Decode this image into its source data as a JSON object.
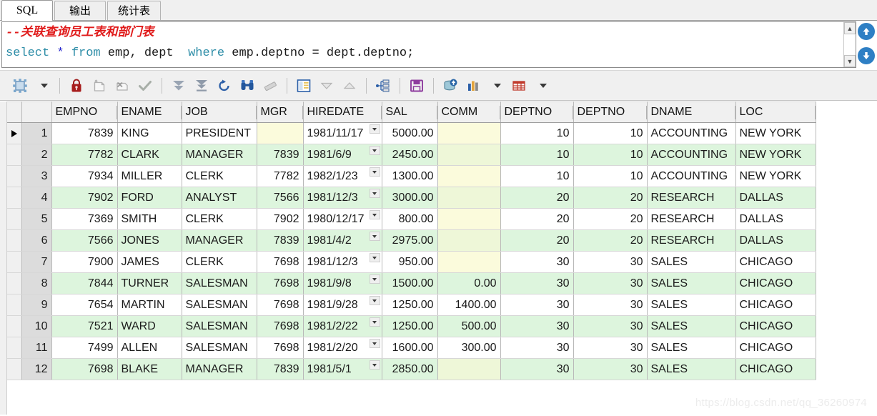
{
  "tabs": [
    {
      "label": "SQL",
      "active": true
    },
    {
      "label": "输出",
      "active": false
    },
    {
      "label": "统计表",
      "active": false
    }
  ],
  "editor": {
    "comment_line": "--关联查询员工表和部门表",
    "sql_tokens": {
      "select": "select",
      "star": "*",
      "from": "from",
      "tables": " emp, dept  ",
      "where": "where",
      "condition": " emp.deptno = dept.deptno;"
    },
    "full_sql": "select * from emp, dept  where emp.deptno = dept.deptno;",
    "scroll_up": "▲",
    "scroll_down": "▼"
  },
  "side_buttons": [
    {
      "name": "scroll-to-top-button",
      "glyph": "↑"
    },
    {
      "name": "scroll-to-bottom-button",
      "glyph": "↓"
    }
  ],
  "toolbar": {
    "items": [
      {
        "name": "grid-view-button",
        "icon": "grid-select-icon",
        "has_caret": true,
        "enabled": true
      },
      {
        "sep": true
      },
      {
        "name": "lock-button",
        "icon": "lock-icon",
        "enabled": true
      },
      {
        "name": "insert-record-button",
        "icon": "new-record-icon",
        "enabled": false
      },
      {
        "name": "delete-record-button",
        "icon": "delete-record-icon",
        "enabled": false
      },
      {
        "name": "post-changes-button",
        "icon": "check-icon",
        "enabled": false
      },
      {
        "sep": true
      },
      {
        "name": "fetch-next-page-button",
        "icon": "double-down-arrow-icon",
        "enabled": true
      },
      {
        "name": "fetch-last-page-button",
        "icon": "down-arrow-to-bar-icon",
        "enabled": true
      },
      {
        "name": "refresh-button",
        "icon": "refresh-icon",
        "enabled": true
      },
      {
        "name": "find-button",
        "icon": "binoculars-icon",
        "enabled": true
      },
      {
        "name": "clear-filter-button",
        "icon": "eraser-icon",
        "enabled": false
      },
      {
        "sep": true
      },
      {
        "name": "single-record-view-button",
        "icon": "record-form-icon",
        "enabled": true
      },
      {
        "name": "previous-record-button",
        "icon": "triangle-down-icon",
        "enabled": false
      },
      {
        "name": "next-record-button",
        "icon": "triangle-up-icon",
        "enabled": false
      },
      {
        "sep": true
      },
      {
        "name": "export-structure-button",
        "icon": "hierarchy-icon",
        "enabled": true
      },
      {
        "sep": true
      },
      {
        "name": "save-button",
        "icon": "floppy-disk-icon",
        "enabled": true
      },
      {
        "sep": true
      },
      {
        "name": "export-query-results-button",
        "icon": "database-export-icon",
        "enabled": true
      },
      {
        "name": "chart-button",
        "icon": "bar-chart-icon",
        "has_caret": true,
        "enabled": true
      },
      {
        "name": "table-options-button",
        "icon": "table-icon",
        "has_caret": true,
        "enabled": true
      }
    ]
  },
  "grid": {
    "columns": [
      {
        "key": "empno",
        "label": "EMPNO",
        "align": "num",
        "width_class": "w-empno"
      },
      {
        "key": "ename",
        "label": "ENAME",
        "align": "txt",
        "width_class": "w-ename"
      },
      {
        "key": "job",
        "label": "JOB",
        "align": "txt",
        "width_class": "w-job"
      },
      {
        "key": "mgr",
        "label": "MGR",
        "align": "num",
        "width_class": "w-mgr"
      },
      {
        "key": "hire",
        "label": "HIREDATE",
        "align": "txt",
        "width_class": "w-hire"
      },
      {
        "key": "sal",
        "label": "SAL",
        "align": "num",
        "width_class": "w-sal"
      },
      {
        "key": "comm",
        "label": "COMM",
        "align": "num",
        "width_class": "w-comm"
      },
      {
        "key": "dept1",
        "label": "DEPTNO",
        "align": "num",
        "width_class": "w-dept1"
      },
      {
        "key": "dept2",
        "label": "DEPTNO",
        "align": "num",
        "width_class": "w-dept2"
      },
      {
        "key": "dname",
        "label": "DNAME",
        "align": "txt",
        "width_class": "w-dname"
      },
      {
        "key": "loc",
        "label": "LOC",
        "align": "txt",
        "width_class": "w-loc"
      }
    ],
    "selected_row": 1,
    "rows": [
      {
        "n": "1",
        "empno": "7839",
        "ename": "KING",
        "job": "PRESIDENT",
        "mgr": "",
        "hire": "1981/11/17",
        "sal": "5000.00",
        "comm": "",
        "dept1": "10",
        "dept2": "10",
        "dname": "ACCOUNTING",
        "loc": "NEW YORK"
      },
      {
        "n": "2",
        "empno": "7782",
        "ename": "CLARK",
        "job": "MANAGER",
        "mgr": "7839",
        "hire": "1981/6/9",
        "sal": "2450.00",
        "comm": "",
        "dept1": "10",
        "dept2": "10",
        "dname": "ACCOUNTING",
        "loc": "NEW YORK"
      },
      {
        "n": "3",
        "empno": "7934",
        "ename": "MILLER",
        "job": "CLERK",
        "mgr": "7782",
        "hire": "1982/1/23",
        "sal": "1300.00",
        "comm": "",
        "dept1": "10",
        "dept2": "10",
        "dname": "ACCOUNTING",
        "loc": "NEW YORK"
      },
      {
        "n": "4",
        "empno": "7902",
        "ename": "FORD",
        "job": "ANALYST",
        "mgr": "7566",
        "hire": "1981/12/3",
        "sal": "3000.00",
        "comm": "",
        "dept1": "20",
        "dept2": "20",
        "dname": "RESEARCH",
        "loc": "DALLAS"
      },
      {
        "n": "5",
        "empno": "7369",
        "ename": "SMITH",
        "job": "CLERK",
        "mgr": "7902",
        "hire": "1980/12/17",
        "sal": "800.00",
        "comm": "",
        "dept1": "20",
        "dept2": "20",
        "dname": "RESEARCH",
        "loc": "DALLAS"
      },
      {
        "n": "6",
        "empno": "7566",
        "ename": "JONES",
        "job": "MANAGER",
        "mgr": "7839",
        "hire": "1981/4/2",
        "sal": "2975.00",
        "comm": "",
        "dept1": "20",
        "dept2": "20",
        "dname": "RESEARCH",
        "loc": "DALLAS"
      },
      {
        "n": "7",
        "empno": "7900",
        "ename": "JAMES",
        "job": "CLERK",
        "mgr": "7698",
        "hire": "1981/12/3",
        "sal": "950.00",
        "comm": "",
        "dept1": "30",
        "dept2": "30",
        "dname": "SALES",
        "loc": "CHICAGO"
      },
      {
        "n": "8",
        "empno": "7844",
        "ename": "TURNER",
        "job": "SALESMAN",
        "mgr": "7698",
        "hire": "1981/9/8",
        "sal": "1500.00",
        "comm": "0.00",
        "dept1": "30",
        "dept2": "30",
        "dname": "SALES",
        "loc": "CHICAGO"
      },
      {
        "n": "9",
        "empno": "7654",
        "ename": "MARTIN",
        "job": "SALESMAN",
        "mgr": "7698",
        "hire": "1981/9/28",
        "sal": "1250.00",
        "comm": "1400.00",
        "dept1": "30",
        "dept2": "30",
        "dname": "SALES",
        "loc": "CHICAGO"
      },
      {
        "n": "10",
        "empno": "7521",
        "ename": "WARD",
        "job": "SALESMAN",
        "mgr": "7698",
        "hire": "1981/2/22",
        "sal": "1250.00",
        "comm": "500.00",
        "dept1": "30",
        "dept2": "30",
        "dname": "SALES",
        "loc": "CHICAGO"
      },
      {
        "n": "11",
        "empno": "7499",
        "ename": "ALLEN",
        "job": "SALESMAN",
        "mgr": "7698",
        "hire": "1981/2/20",
        "sal": "1600.00",
        "comm": "300.00",
        "dept1": "30",
        "dept2": "30",
        "dname": "SALES",
        "loc": "CHICAGO"
      },
      {
        "n": "12",
        "empno": "7698",
        "ename": "BLAKE",
        "job": "MANAGER",
        "mgr": "7839",
        "hire": "1981/5/1",
        "sal": "2850.00",
        "comm": "",
        "dept1": "30",
        "dept2": "30",
        "dname": "SALES",
        "loc": "CHICAGO"
      }
    ]
  },
  "watermark": "https://blog.csdn.net/qq_36260974",
  "colors": {
    "accent_blue": "#2e7fc4",
    "row_alt_green": "#ddf5dd",
    "null_yellow": "#fbfbdc",
    "comment_red": "#e01b1b",
    "keyword_teal": "#2f8ea8",
    "rownum_gray": "#dcdcdc"
  }
}
